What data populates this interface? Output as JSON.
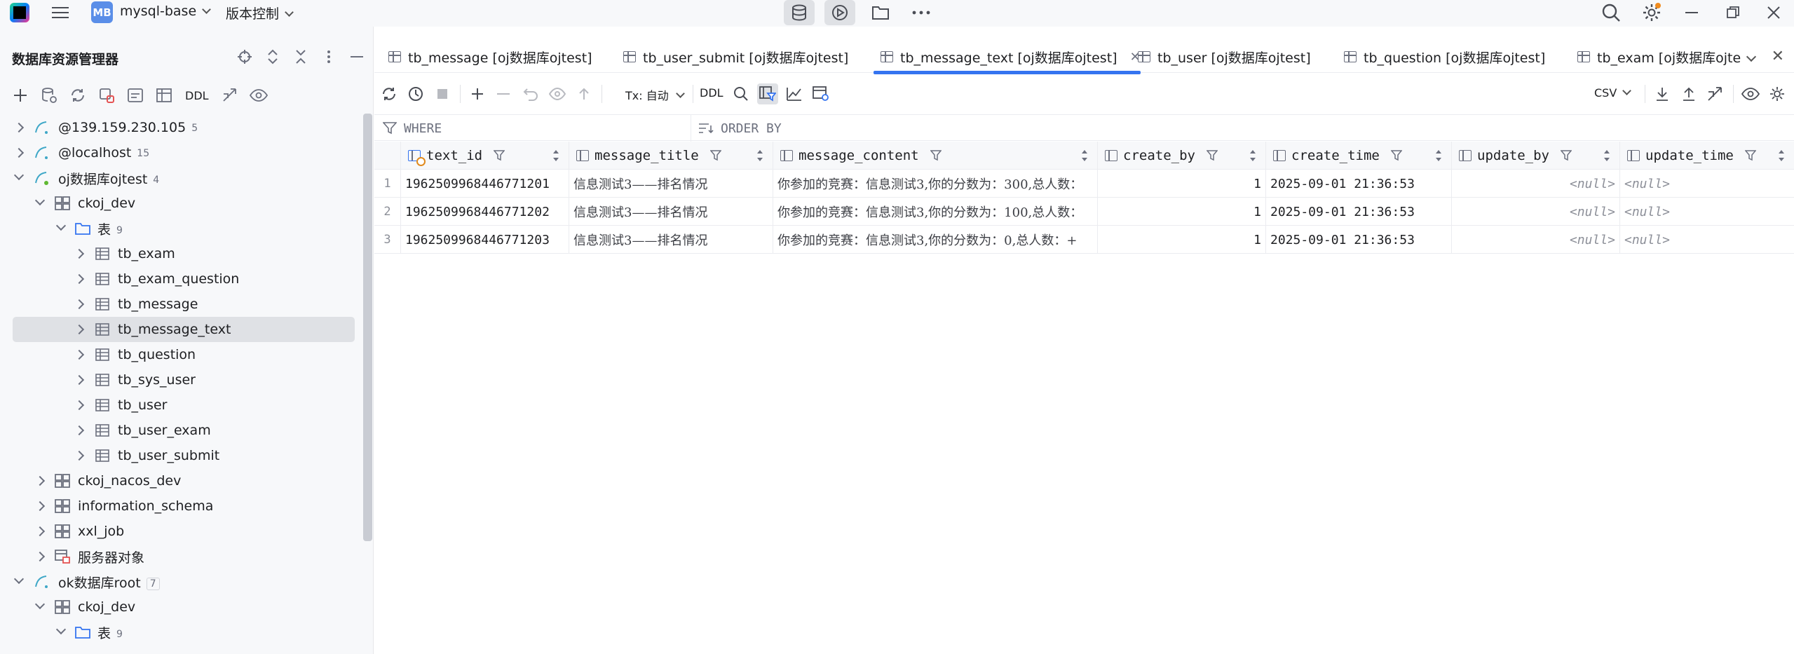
{
  "titlebar": {
    "project_badge": "MB",
    "project_name": "mysql-base",
    "vcs_label": "版本控制"
  },
  "left_panel": {
    "title": "数据库资源管理器",
    "toolbar_ddl": "DDL",
    "tree": [
      {
        "label": "@139.159.230.105",
        "count": "5"
      },
      {
        "label": "@localhost",
        "count": "15"
      },
      {
        "label": "oj数据库ojtest",
        "count": "4"
      },
      {
        "label": "ckoj_dev"
      },
      {
        "label": "表",
        "count": "9"
      },
      {
        "label": "tb_exam"
      },
      {
        "label": "tb_exam_question"
      },
      {
        "label": "tb_message"
      },
      {
        "label": "tb_message_text"
      },
      {
        "label": "tb_question"
      },
      {
        "label": "tb_sys_user"
      },
      {
        "label": "tb_user"
      },
      {
        "label": "tb_user_exam"
      },
      {
        "label": "tb_user_submit"
      },
      {
        "label": "ckoj_nacos_dev"
      },
      {
        "label": "information_schema"
      },
      {
        "label": "xxl_job"
      },
      {
        "label": "服务器对象"
      },
      {
        "label": "ok数据库root",
        "count": "7"
      },
      {
        "label": "ckoj_dev"
      },
      {
        "label": "表",
        "count": "9"
      }
    ]
  },
  "tabs": [
    {
      "label": "tb_message [oj数据库ojtest]"
    },
    {
      "label": "tb_user_submit [oj数据库ojtest]"
    },
    {
      "label": "tb_message_text [oj数据库ojtest]"
    },
    {
      "label": "tb_user [oj数据库ojtest]"
    },
    {
      "label": "tb_question [oj数据库ojtest]"
    },
    {
      "label": "tb_exam [oj数据库ojte"
    }
  ],
  "toolbar": {
    "tx_label": "Tx: 自动",
    "ddl_label": "DDL",
    "csv_label": "CSV"
  },
  "filter": {
    "where": "WHERE",
    "order_by": "ORDER BY"
  },
  "grid": {
    "columns": [
      "text_id",
      "message_title",
      "message_content",
      "create_by",
      "create_time",
      "update_by",
      "update_time"
    ],
    "rows": [
      {
        "num": "1",
        "text_id": "1962509968446771201",
        "message_title": "信息测试3——排名情况",
        "message_content": "你参加的竞赛：信息测试3,你的分数为：300,总人数：",
        "create_by": "1",
        "create_time": "2025-09-01 21:36:53",
        "update_by": "<null>",
        "update_time": "<null>"
      },
      {
        "num": "2",
        "text_id": "1962509968446771202",
        "message_title": "信息测试3——排名情况",
        "message_content": "你参加的竞赛：信息测试3,你的分数为：100,总人数：",
        "create_by": "1",
        "create_time": "2025-09-01 21:36:53",
        "update_by": "<null>",
        "update_time": "<null>"
      },
      {
        "num": "3",
        "text_id": "1962509968446771203",
        "message_title": "信息测试3——排名情况",
        "message_content": "你参加的竞赛：信息测试3,你的分数为：0,总人数：+",
        "create_by": "1",
        "create_time": "2025-09-01 21:36:53",
        "update_by": "<null>",
        "update_time": "<null>"
      }
    ]
  },
  "colors": {
    "accent": "#3574f0",
    "selection": "#dfe1e5",
    "panel_bg": "#f7f8fa"
  }
}
